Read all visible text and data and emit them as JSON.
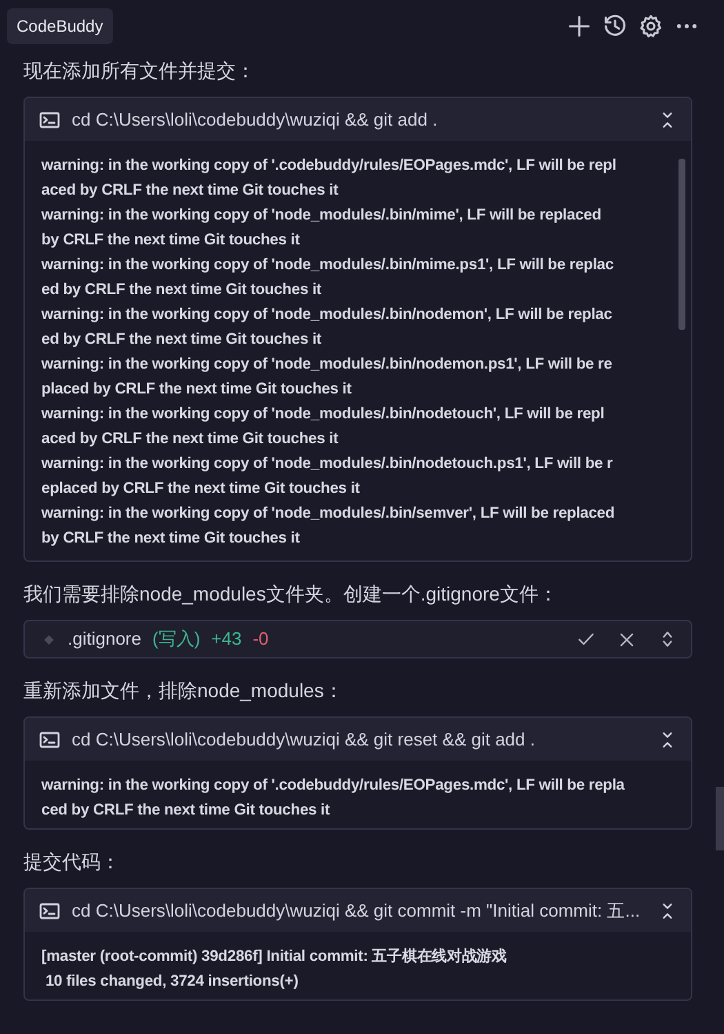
{
  "app": {
    "title": "CodeBuddy"
  },
  "messages": [
    {
      "kind": "text",
      "text": "现在添加所有文件并提交："
    },
    {
      "kind": "terminal",
      "command": "cd C:\\Users\\loli\\codebuddy\\wuziqi && git add .",
      "scrollable": true,
      "output": [
        "warning: in the working copy of '.codebuddy/rules/EOPages.mdc', LF will be repl",
        "aced by CRLF the next time Git touches it",
        "warning: in the working copy of 'node_modules/.bin/mime', LF will be replaced",
        "by CRLF the next time Git touches it",
        "warning: in the working copy of 'node_modules/.bin/mime.ps1', LF will be replac",
        "ed by CRLF the next time Git touches it",
        "warning: in the working copy of 'node_modules/.bin/nodemon', LF will be replac",
        "ed by CRLF the next time Git touches it",
        "warning: in the working copy of 'node_modules/.bin/nodemon.ps1', LF will be re",
        "placed by CRLF the next time Git touches it",
        "warning: in the working copy of 'node_modules/.bin/nodetouch', LF will be repl",
        "aced by CRLF the next time Git touches it",
        "warning: in the working copy of 'node_modules/.bin/nodetouch.ps1', LF will be r",
        "eplaced by CRLF the next time Git touches it",
        "warning: in the working copy of 'node_modules/.bin/semver', LF will be replaced",
        "by CRLF the next time Git touches it"
      ]
    },
    {
      "kind": "text",
      "text": "我们需要排除node_modules文件夹。创建一个.gitignore文件："
    },
    {
      "kind": "file",
      "name": ".gitignore",
      "action": "(写入)",
      "added": "+43",
      "removed": "-0"
    },
    {
      "kind": "text",
      "text": "重新添加文件，排除node_modules："
    },
    {
      "kind": "terminal",
      "command": "cd C:\\Users\\loli\\codebuddy\\wuziqi && git reset && git add .",
      "scrollable": false,
      "output": [
        "warning: in the working copy of '.codebuddy/rules/EOPages.mdc', LF will be repla",
        "ced by CRLF the next time Git touches it"
      ]
    },
    {
      "kind": "text",
      "text": "提交代码："
    },
    {
      "kind": "terminal",
      "command": "cd C:\\Users\\loli\\codebuddy\\wuziqi && git commit -m \"Initial commit: 五...",
      "scrollable": false,
      "output": [
        "[master (root-commit) 39d286f] Initial commit: 五子棋在线对战游戏",
        " 10 files changed, 3724 insertions(+)"
      ]
    }
  ]
}
